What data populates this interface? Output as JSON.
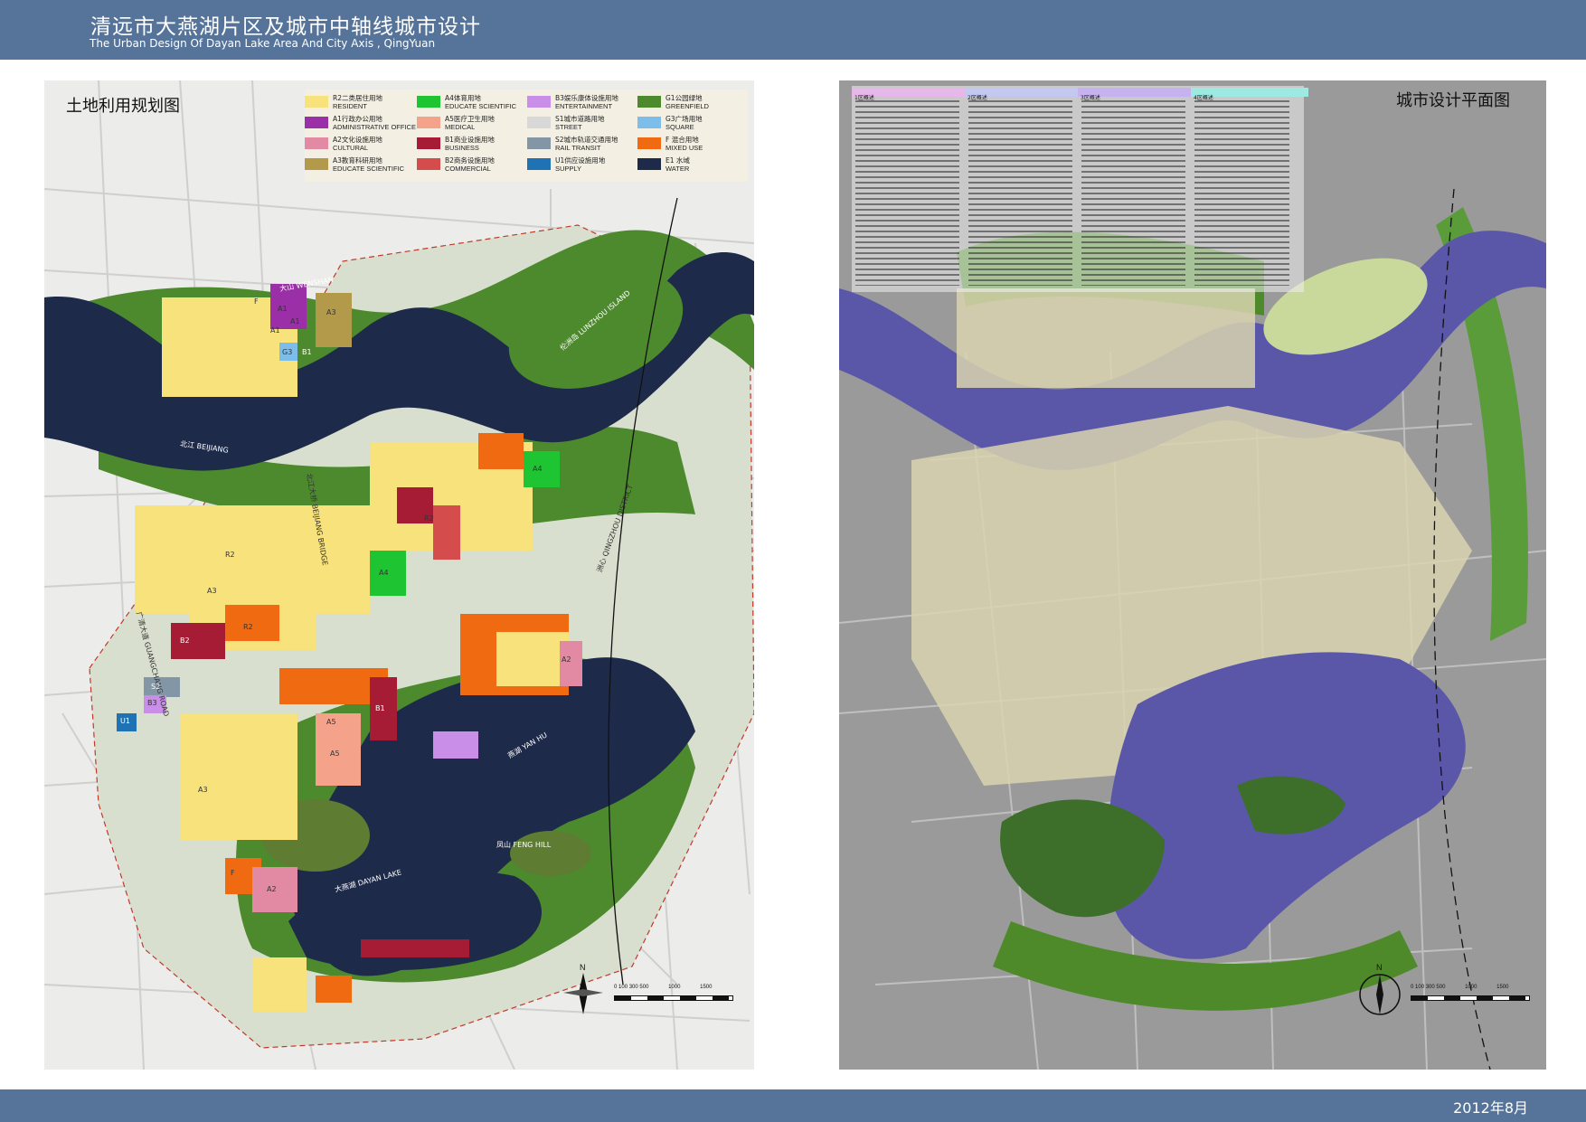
{
  "header": {
    "title_cn": "清远市大燕湖片区及城市中轴线城市设计",
    "title_en": "The Urban Design Of Dayan Lake Area And City Axis , QingYuan"
  },
  "footer": {
    "date": "2012年8月"
  },
  "left_panel": {
    "title": "土地利用规划图",
    "legend": [
      {
        "cn": "R2二类居住用地",
        "en": "RESIDENT",
        "color": "#f7e27c"
      },
      {
        "cn": "A1行政办公用地",
        "en": "ADMINISTRATIVE OFFICE",
        "color": "#9b2fa7"
      },
      {
        "cn": "A2文化设施用地",
        "en": "CULTURAL",
        "color": "#e28aa3"
      },
      {
        "cn": "A3教育科研用地",
        "en": "EDUCATE SCIENTIFIC",
        "color": "#b29a4a"
      },
      {
        "cn": "A4体育用地",
        "en": "EDUCATE SCIENTIFIC",
        "color": "#1ec431"
      },
      {
        "cn": "A5医疗卫生用地",
        "en": "MEDICAL",
        "color": "#f4a28a"
      },
      {
        "cn": "B1商业设施用地",
        "en": "BUSINESS",
        "color": "#a71c35"
      },
      {
        "cn": "B2商务设施用地",
        "en": "COMMERCIAL",
        "color": "#d44c4c"
      },
      {
        "cn": "B3娱乐康体设施用地",
        "en": "ENTERTAINMENT",
        "color": "#c88ee8"
      },
      {
        "cn": "S1城市道路用地",
        "en": "STREET",
        "color": "#ffffff"
      },
      {
        "cn": "S2城市轨道交通用地",
        "en": "RAIL TRANSIT",
        "color": "#8396a6"
      },
      {
        "cn": "U1供应设施用地",
        "en": "SUPPLY",
        "color": "#1f73b4"
      },
      {
        "cn": "G1公园绿地",
        "en": "GREENFIELD",
        "color": "#4c8a2d"
      },
      {
        "cn": "G3广场用地",
        "en": "SQUARE",
        "color": "#7dbde9"
      },
      {
        "cn": "F 混合用地",
        "en": "MIXED USE",
        "color": "#f06a12"
      },
      {
        "cn": "E1 水域",
        "en": "WATER",
        "color": "#1e2a4a"
      }
    ],
    "place_labels": [
      "大燕湖 DAYAN LAKE",
      "北江 BEIJIANG",
      "凤山 FENG HILL",
      "大山 WENSHAN",
      "伦洲岛 LUNZHOU ISLAND",
      "燕湖 YAN HU",
      "广清大道 GUANGCHANG ROAD",
      "北江大桥 BEIJIANG BRIDGE",
      "洲心 QINGZHOU DISTRICT"
    ],
    "block_labels": [
      "A1",
      "A1",
      "A1",
      "A3",
      "G3",
      "B1",
      "F",
      "R2",
      "R2",
      "A3",
      "A4",
      "A4",
      "A5",
      "A5",
      "A2",
      "A2",
      "A3",
      "B2",
      "B3",
      "B1",
      "S2",
      "U1",
      "R2",
      "F"
    ],
    "scale": {
      "ticks": [
        "0",
        "100",
        "300",
        "500",
        "1000",
        "1500"
      ]
    }
  },
  "right_panel": {
    "title": "城市设计平面图",
    "index_headings": [
      "1区概述",
      "2区概述",
      "3区概述",
      "4区概述"
    ],
    "index_heading_colors": [
      "#e6b7e9",
      "#c3c8f1",
      "#c6b2ee",
      "#9fe9e3"
    ],
    "scale": {
      "ticks": [
        "0",
        "100",
        "300",
        "500",
        "1000",
        "1500"
      ]
    }
  }
}
